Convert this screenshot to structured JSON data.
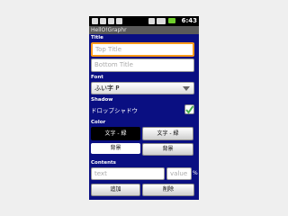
{
  "status": {
    "time": "6:43"
  },
  "app": {
    "title": "HellO!Graphr"
  },
  "sections": {
    "title": "Title",
    "font": "Font",
    "shadow": "Shadow",
    "color": "Color",
    "contents": "Contents"
  },
  "title_fields": {
    "top_placeholder": "Top Title",
    "bottom_placeholder": "Bottom Title"
  },
  "font": {
    "selected": "ふい字 P"
  },
  "shadow": {
    "label": "ドロップシャドウ",
    "checked": true
  },
  "color": {
    "text_black": "文字 - 緑",
    "text_white": "文字 - 緑",
    "bg_black": "背景",
    "bg_white": "背景"
  },
  "contents": {
    "text_placeholder": "text",
    "value_placeholder": "value",
    "unit": "%",
    "add_label": "追加",
    "delete_label": "削除"
  },
  "colors": {
    "accent": "#0a0f82",
    "focus": "#ff9a1a",
    "check": "#4caf50"
  }
}
